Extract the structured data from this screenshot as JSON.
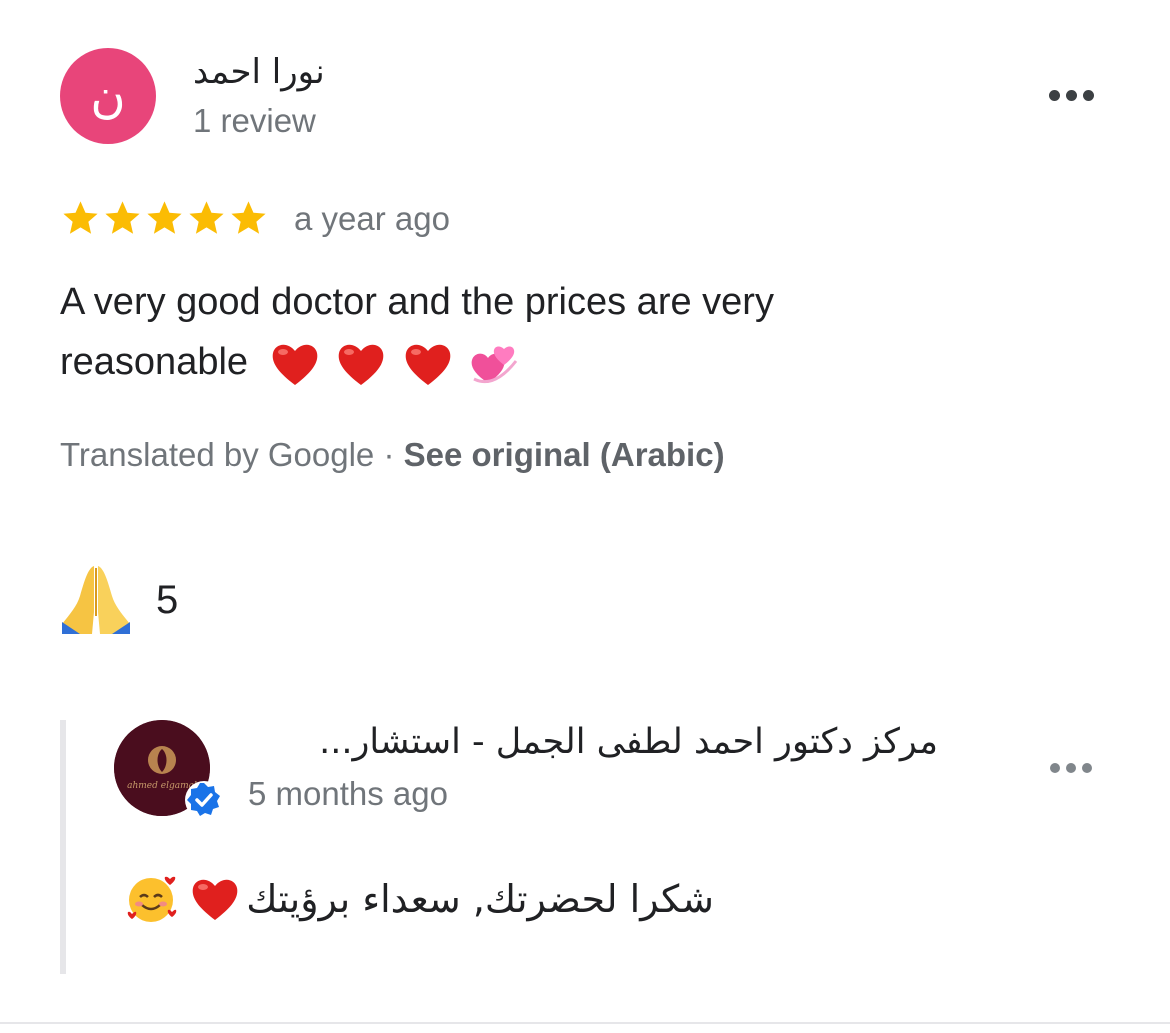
{
  "review": {
    "reviewer_initial": "ن",
    "reviewer_name": "نورا احمد",
    "reviewer_review_count": "1 review",
    "rating": 5,
    "rating_max": 5,
    "time": "a year ago",
    "text": "A very good doctor and the prices are very reasonable",
    "text_emojis": [
      "red-heart-icon",
      "red-heart-icon",
      "red-heart-icon",
      "revolving-hearts-icon"
    ],
    "translated_by": "Translated by Google",
    "separator": "·",
    "see_original": "See original (Arabic)",
    "like_emoji": "folded-hands-icon",
    "like_count": "5",
    "star_color": "#fbbc04",
    "avatar_color": "#e8457a"
  },
  "reply": {
    "owner_name": "مركز دكتور احمد لطفى الجمل - استشار...",
    "owner_logo_text": "ahmed elgamal",
    "time": "5 months ago",
    "text": "شكرا لحضرتك, سعداء برؤيتك",
    "text_emojis": [
      "red-heart-icon",
      "smiling-face-with-hearts-icon"
    ],
    "verified_color": "#1a73e8"
  }
}
